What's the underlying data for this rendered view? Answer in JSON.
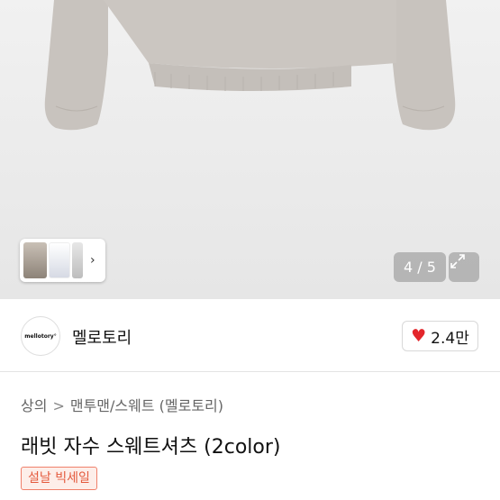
{
  "gallery": {
    "counter": "4 / 5",
    "thumb_arrow": "›",
    "zoom_icon": "expand-icon"
  },
  "shop": {
    "logo_text": "mellotory°",
    "name": "멜로토리",
    "like_count": "2.4만",
    "like_color": "#e3262b"
  },
  "breadcrumb": {
    "items": [
      "상의",
      "맨투맨/스웨트 (멜로토리)"
    ],
    "separator": ">"
  },
  "product": {
    "title": "래빗 자수 스웨트셔츠 (2color)",
    "badge": "설날 빅세일"
  }
}
